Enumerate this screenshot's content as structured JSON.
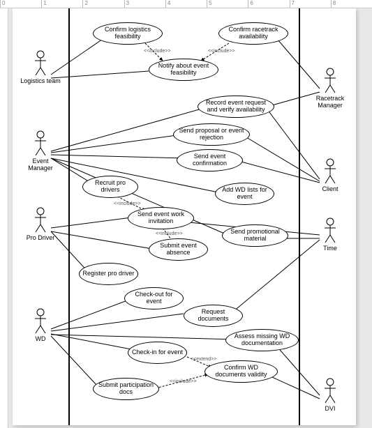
{
  "ruler": [
    "0",
    "1",
    "2",
    "3",
    "4",
    "5",
    "6",
    "7",
    "8"
  ],
  "actors": {
    "logistics": "Logistics team",
    "eventmgr": "Event Manager",
    "prodriver": "Pro Driver",
    "wd": "WD",
    "racetrack": "Racetrack Manager",
    "client": "Client",
    "time": "Time",
    "dvi": "DVI"
  },
  "usecases": {
    "confirm_logistics": "Confirm logistics feasibility",
    "confirm_racetrack": "Confirm racetrack availability",
    "notify": "Notify about event feasibility",
    "record_request": "Record event request and verify availability",
    "send_proposal": "Send proposal or event rejection",
    "send_confirm": "Send event confirmation",
    "recruit": "Recruit pro drivers",
    "add_wd": "Add WD lists for event",
    "send_work_inv": "Send event work invitation",
    "send_promo": "Send promotional material",
    "submit_absence": "Submit event absence",
    "register_pro": "Register pro driver",
    "checkout": "Check-out for event",
    "request_docs": "Request documents",
    "assess_missing": "Assess missing WD documentation",
    "checkin": "Check-in for event",
    "confirm_wd_docs": "Confirm WD documents validity",
    "submit_part": "Submit participation docs"
  },
  "stereotypes": {
    "include": "<<include>>",
    "extend": "<<extend>>"
  }
}
